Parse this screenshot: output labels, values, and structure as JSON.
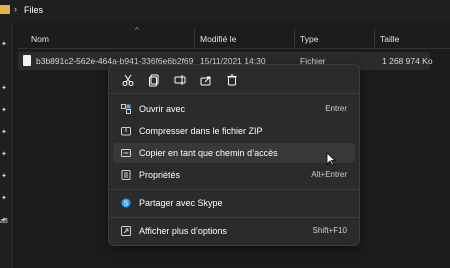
{
  "breadcrumb": {
    "title": "Files"
  },
  "columns": {
    "name": "Nom",
    "modified": "Modifié le",
    "type": "Type",
    "size": "Taille"
  },
  "file_row": {
    "name": "b3b891c2-562e-464a-b941-336f6e6b2f69",
    "modified": "15/11/2021 14:30",
    "type": "Fichier",
    "size": "1 268 974 Ko"
  },
  "left_panel": {
    "partial_text": "a3"
  },
  "context_menu": {
    "toolbar": [
      "cut-icon",
      "copy-icon",
      "rename-icon",
      "share-icon",
      "delete-icon"
    ],
    "items": [
      {
        "label": "Ouvrir avec",
        "shortcut": "Entrer",
        "icon": "open-with-icon"
      },
      {
        "label": "Compresser dans le fichier ZIP",
        "shortcut": "",
        "icon": "zip-icon"
      },
      {
        "label": "Copier en tant que chemin d’accès",
        "shortcut": "",
        "icon": "copy-path-icon"
      },
      {
        "label": "Propriétés",
        "shortcut": "Alt+Entrer",
        "icon": "properties-icon"
      },
      {
        "label": "Partager avec Skype",
        "shortcut": "",
        "icon": "skype-icon"
      },
      {
        "label": "Afficher plus d’options",
        "shortcut": "Shift+F10",
        "icon": "more-options-icon"
      }
    ]
  },
  "colors": {
    "background": "#1c1c1c",
    "menu": "#2b2b2b",
    "folder": "#e6b54a",
    "skype": "#2a9df4"
  }
}
